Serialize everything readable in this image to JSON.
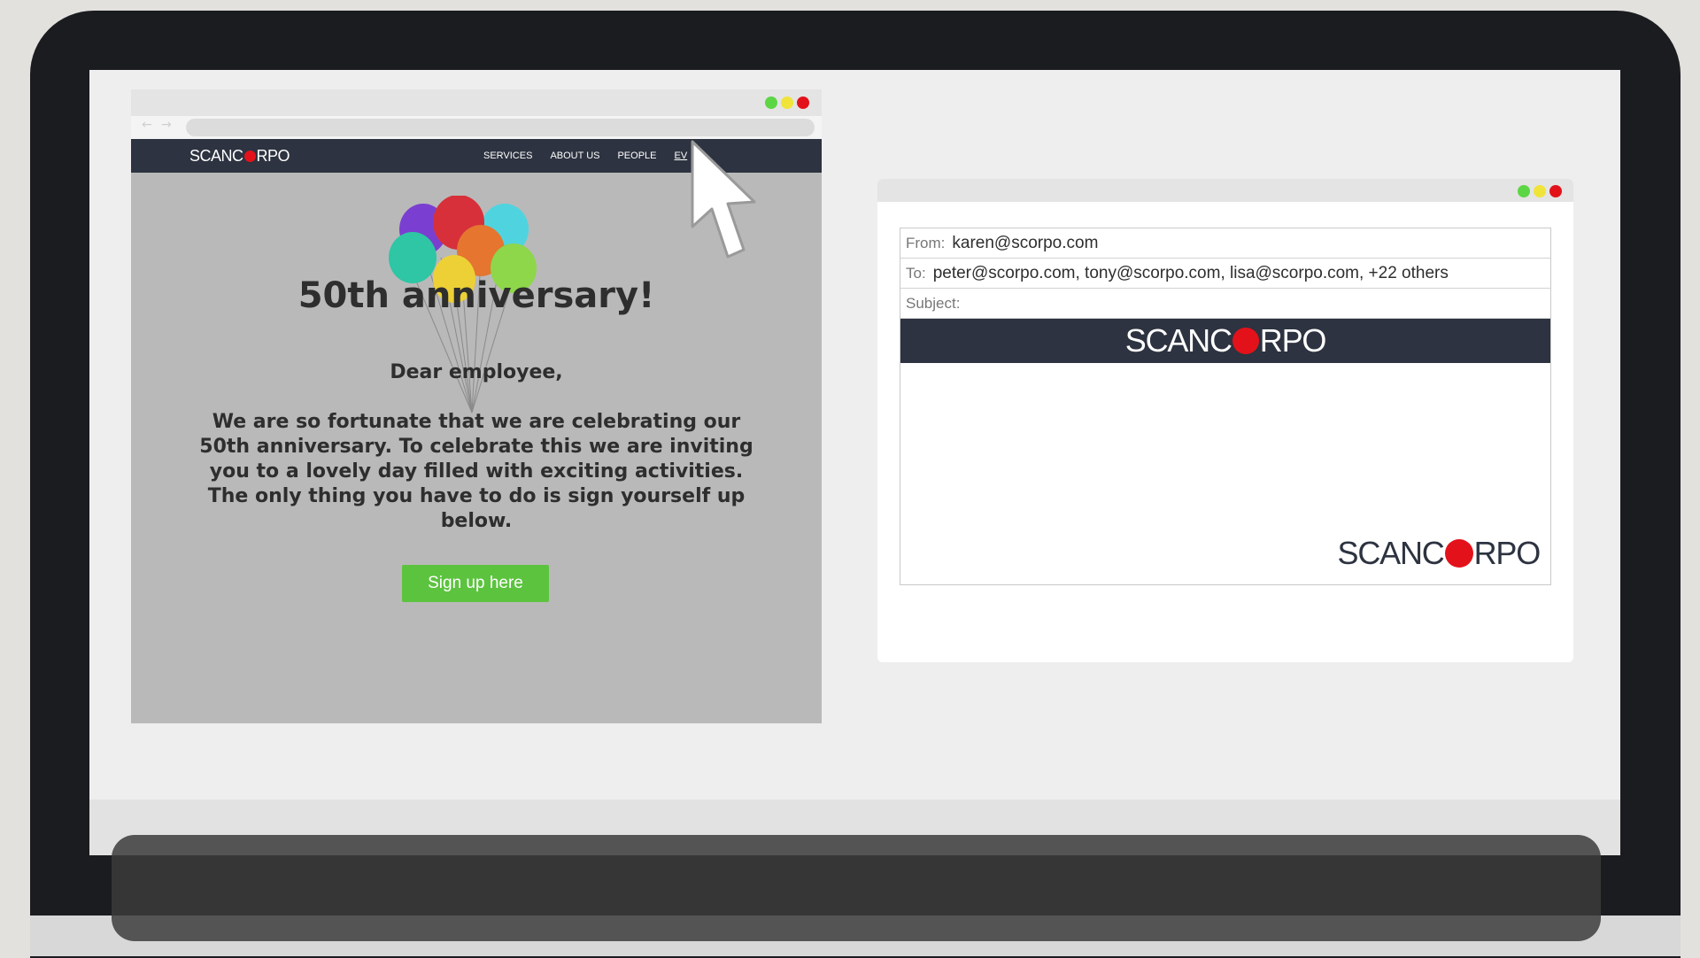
{
  "browser": {
    "nav_back": "←",
    "nav_forward": "→",
    "site": {
      "logo_left": "SCANC",
      "logo_right": "RPO",
      "nav_links": [
        "SERVICES",
        "ABOUT US",
        "PEOPLE",
        "EV"
      ],
      "headline": "50th anniversary!",
      "greeting": "Dear employee,",
      "body": "We are so fortunate that we are celebrating our 50th anniversary. To celebrate this we are inviting you to a lovely day filled with exciting activities. The only thing you have to do is sign yourself up below.",
      "signup_label": "Sign up here"
    }
  },
  "email": {
    "from_label": "From:",
    "from_value": "karen@scorpo.com",
    "to_label": "To:",
    "to_value": "peter@scorpo.com, tony@scorpo.com, lisa@scorpo.com, +22 others",
    "subject_label": "Subject:",
    "subject_value": "",
    "logo_left": "SCANC",
    "logo_right": "RPO"
  },
  "colors": {
    "brand_red": "#e3121a",
    "nav_dark": "#2d3340",
    "signup_green": "#5cc33f",
    "window_green": "#5cd644",
    "window_yellow": "#f0e43a"
  }
}
